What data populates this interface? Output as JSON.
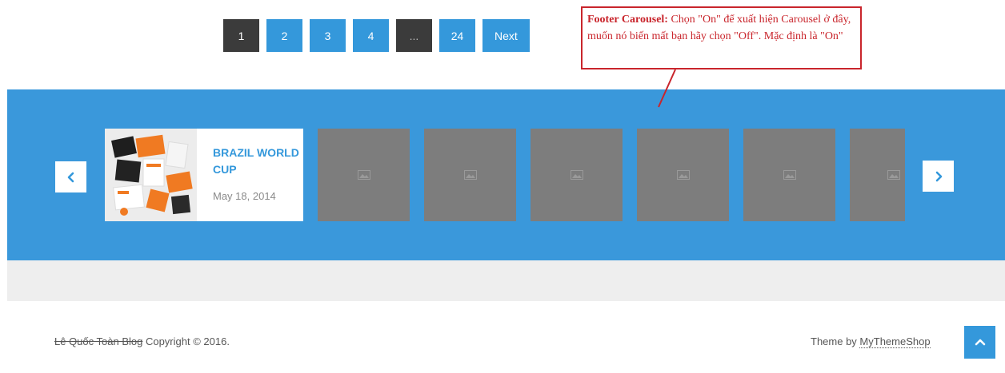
{
  "pagination": {
    "pages": [
      "1",
      "2",
      "3",
      "4",
      "...",
      "24"
    ],
    "next_label": "Next",
    "current": "1"
  },
  "annotation": {
    "bold": "Footer Carousel:",
    "text": " Chọn \"On\" để xuất hiện Carousel ở đây, muốn nó biến mất bạn hãy chọn \"Off\". Mặc định là \"On\""
  },
  "carousel": {
    "featured_post": {
      "title": "BRAZIL WORLD CUP",
      "date": "May 18, 2014"
    },
    "placeholder_count": 6,
    "colors": {
      "band": "#3a98db",
      "placeholder": "#7d7d7d",
      "accent": "#3498db"
    },
    "icons": {
      "prev": "chevron-left-icon",
      "next": "chevron-right-icon",
      "placeholder": "image-icon"
    }
  },
  "footer": {
    "blog_name": "Lê Quốc Toàn Blog",
    "copyright": " Copyright © 2016.",
    "theme_prefix": "Theme by ",
    "theme_name": "MyThemeShop",
    "scroll_top_icon": "chevron-up-icon"
  }
}
